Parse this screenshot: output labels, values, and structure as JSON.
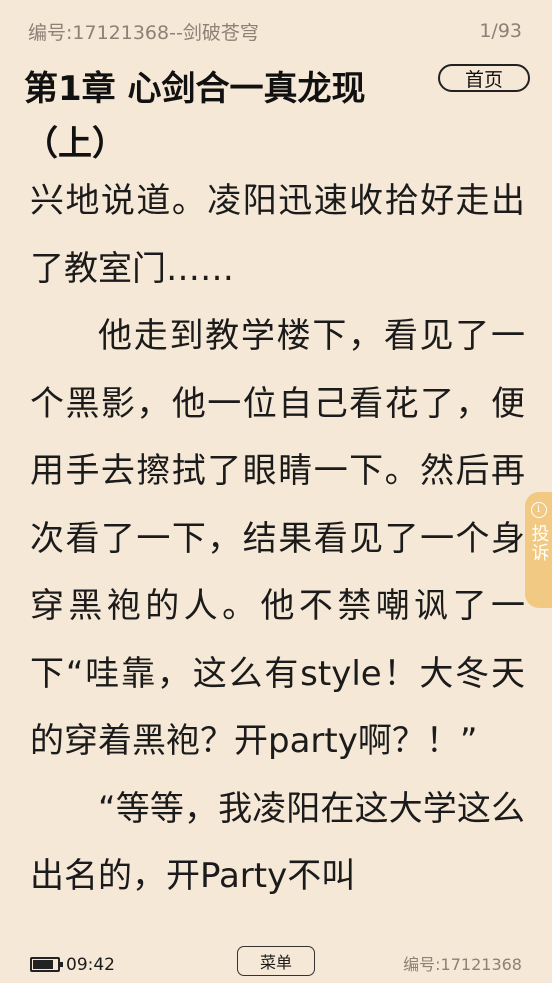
{
  "header": {
    "book_info": "编号:17121368--剑破苍穹",
    "page_indicator": "1/93"
  },
  "chapter": {
    "title": "第1章 心剑合一真龙现（上）",
    "home_label": "首页"
  },
  "content": {
    "paragraphs": [
      "兴地说道。凌阳迅速收拾好走出了教室门……",
      "他走到教学楼下，看见了一个黑影，他一位自己看花了，便用手去擦拭了眼睛一下。然后再次看了一下，结果看见了一个身穿黑袍的人。他不禁嘲讽了一下“哇靠，这么有style！大冬天的穿着黑袍？开party啊？！”",
      "“等等，我凌阳在这大学这么出名的，开Party不叫"
    ]
  },
  "side_tab": {
    "icon": "info-icon",
    "label": "投诉",
    "color": "#f1c982"
  },
  "footer": {
    "battery_level": 0.85,
    "time": "09:42",
    "menu_label": "菜单",
    "book_id": "编号:17121368"
  },
  "colors": {
    "background": "#f6e8d6",
    "text": "#1b1b1b",
    "muted": "#8b8176"
  }
}
